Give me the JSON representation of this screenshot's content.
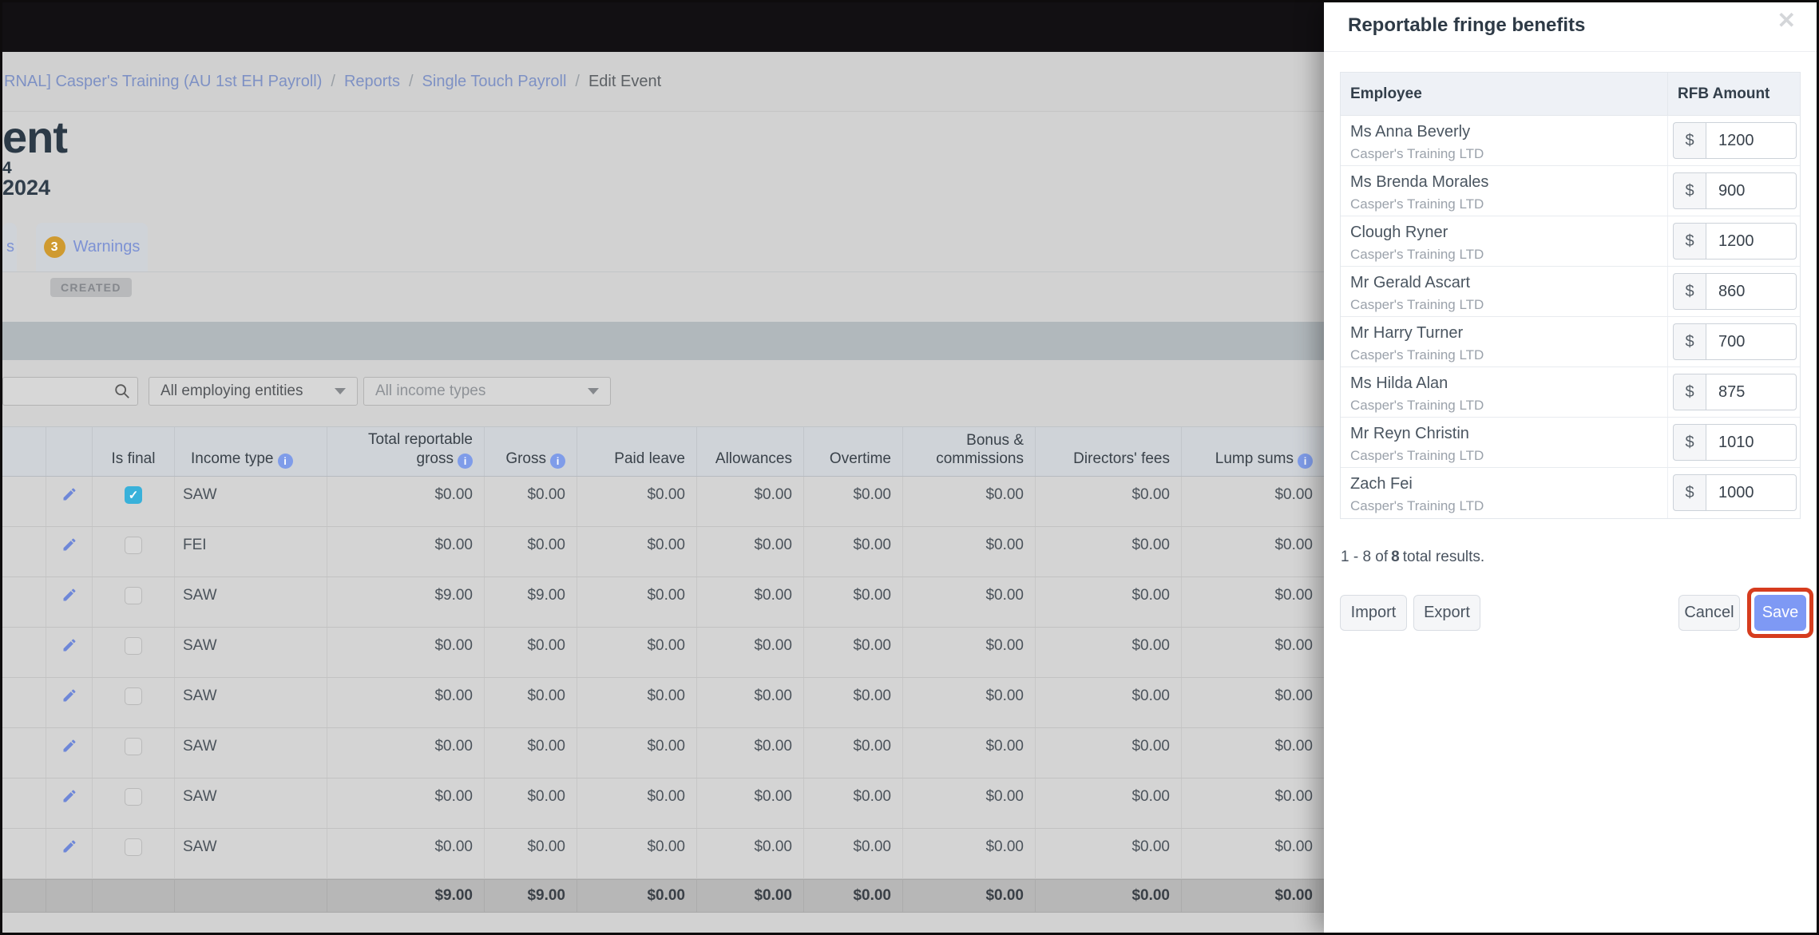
{
  "icons": {
    "info_glyph": "i",
    "close_glyph": "✕",
    "check_glyph": "✓"
  },
  "breadcrumb": {
    "separator": "/",
    "items": [
      "RNAL] Casper's Training (AU 1st EH Payroll)",
      "Reports",
      "Single Touch Payroll",
      "Edit Event"
    ]
  },
  "page": {
    "title_fragment": "ent",
    "date_fragment_1": "4",
    "date_fragment_2": "2024",
    "tabs": {
      "partial_label": "s",
      "warnings_count": "3",
      "warnings_label": "Warnings"
    },
    "status_badge": "CREATED",
    "filters": {
      "entities": "All employing entities",
      "income_types": "All income types"
    }
  },
  "main_table": {
    "headers": {
      "is_final": "Is final",
      "income_type": "Income type",
      "total_reportable_gross": "Total reportable gross",
      "gross": "Gross",
      "paid_leave": "Paid leave",
      "allowances": "Allowances",
      "overtime": "Overtime",
      "bonus_commissions": "Bonus & commissions",
      "directors_fees": "Directors' fees",
      "lump_sums": "Lump sums"
    },
    "rows": [
      {
        "income_type": "SAW",
        "is_final": true,
        "values": [
          "$0.00",
          "$0.00",
          "$0.00",
          "$0.00",
          "$0.00",
          "$0.00",
          "$0.00",
          "$0.00"
        ]
      },
      {
        "income_type": "FEI",
        "is_final": false,
        "values": [
          "$0.00",
          "$0.00",
          "$0.00",
          "$0.00",
          "$0.00",
          "$0.00",
          "$0.00",
          "$0.00"
        ]
      },
      {
        "income_type": "SAW",
        "is_final": false,
        "values": [
          "$9.00",
          "$9.00",
          "$0.00",
          "$0.00",
          "$0.00",
          "$0.00",
          "$0.00",
          "$0.00"
        ]
      },
      {
        "income_type": "SAW",
        "is_final": false,
        "values": [
          "$0.00",
          "$0.00",
          "$0.00",
          "$0.00",
          "$0.00",
          "$0.00",
          "$0.00",
          "$0.00"
        ]
      },
      {
        "income_type": "SAW",
        "is_final": false,
        "values": [
          "$0.00",
          "$0.00",
          "$0.00",
          "$0.00",
          "$0.00",
          "$0.00",
          "$0.00",
          "$0.00"
        ]
      },
      {
        "income_type": "SAW",
        "is_final": false,
        "values": [
          "$0.00",
          "$0.00",
          "$0.00",
          "$0.00",
          "$0.00",
          "$0.00",
          "$0.00",
          "$0.00"
        ]
      },
      {
        "income_type": "SAW",
        "is_final": false,
        "values": [
          "$0.00",
          "$0.00",
          "$0.00",
          "$0.00",
          "$0.00",
          "$0.00",
          "$0.00",
          "$0.00"
        ]
      },
      {
        "income_type": "SAW",
        "is_final": false,
        "values": [
          "$0.00",
          "$0.00",
          "$0.00",
          "$0.00",
          "$0.00",
          "$0.00",
          "$0.00",
          "$0.00"
        ]
      }
    ],
    "totals": [
      "$9.00",
      "$9.00",
      "$0.00",
      "$0.00",
      "$0.00",
      "$0.00",
      "$0.00",
      "$0.00"
    ]
  },
  "modal": {
    "title": "Reportable fringe benefits",
    "currency_symbol": "$",
    "table": {
      "employee_header": "Employee",
      "amount_header": "RFB Amount",
      "rows": [
        {
          "name": "Ms Anna Beverly",
          "company": "Casper's Training LTD",
          "amount": "1200"
        },
        {
          "name": "Ms Brenda Morales",
          "company": "Casper's Training LTD",
          "amount": "900"
        },
        {
          "name": "Clough Ryner",
          "company": "Casper's Training LTD",
          "amount": "1200"
        },
        {
          "name": "Mr Gerald Ascart",
          "company": "Casper's Training LTD",
          "amount": "860"
        },
        {
          "name": "Mr Harry Turner",
          "company": "Casper's Training LTD",
          "amount": "700"
        },
        {
          "name": "Ms Hilda Alan",
          "company": "Casper's Training LTD",
          "amount": "875"
        },
        {
          "name": "Mr Reyn Christin",
          "company": "Casper's Training LTD",
          "amount": "1010"
        },
        {
          "name": "Zach Fei",
          "company": "Casper's Training LTD",
          "amount": "1000"
        }
      ]
    },
    "results": {
      "prefix": "1 - 8 of",
      "total": "8",
      "suffix": "total results."
    },
    "buttons": {
      "import": "Import",
      "export": "Export",
      "cancel": "Cancel",
      "save": "Save"
    }
  }
}
